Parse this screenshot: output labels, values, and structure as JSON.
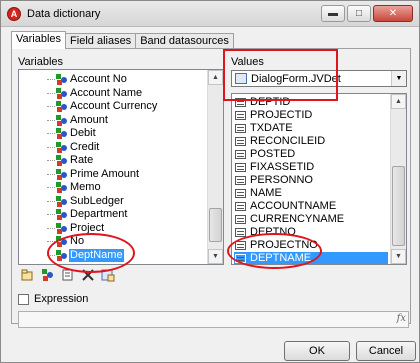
{
  "window": {
    "title": "Data dictionary",
    "app_icon_letter": "A",
    "controls": {
      "minimize": "▬",
      "maximize": "□",
      "close": "✕"
    }
  },
  "tabs": [
    {
      "label": "Variables",
      "active": true
    },
    {
      "label": "Field aliases",
      "active": false
    },
    {
      "label": "Band datasources",
      "active": false
    }
  ],
  "variables_panel": {
    "label": "Variables",
    "items": [
      {
        "label": "Account No"
      },
      {
        "label": "Account Name"
      },
      {
        "label": "Account Currency"
      },
      {
        "label": "Amount"
      },
      {
        "label": "Debit"
      },
      {
        "label": "Credit"
      },
      {
        "label": "Rate"
      },
      {
        "label": "Prime Amount"
      },
      {
        "label": "Memo"
      },
      {
        "label": "SubLedger"
      },
      {
        "label": "Department"
      },
      {
        "label": "Project"
      },
      {
        "label": "No"
      },
      {
        "label": "DeptName",
        "selected": true
      }
    ]
  },
  "values_panel": {
    "label": "Values",
    "datasource": "DialogForm.JVDet",
    "fields": [
      {
        "label": "DEPTID"
      },
      {
        "label": "PROJECTID"
      },
      {
        "label": "TXDATE"
      },
      {
        "label": "RECONCILEID"
      },
      {
        "label": "POSTED"
      },
      {
        "label": "FIXASSETID"
      },
      {
        "label": "PERSONNO"
      },
      {
        "label": "NAME"
      },
      {
        "label": "ACCOUNTNAME"
      },
      {
        "label": "CURRENCYNAME"
      },
      {
        "label": "DEPTNO"
      },
      {
        "label": "PROJECTNO"
      },
      {
        "label": "DEPTNAME",
        "selected": true
      }
    ]
  },
  "expression": {
    "label": "Expression",
    "checked": false,
    "fx_label": "fx"
  },
  "buttons": {
    "ok": "OK",
    "cancel": "Cancel"
  },
  "colors": {
    "highlight": "#e0141f",
    "selection": "#3399ff"
  }
}
